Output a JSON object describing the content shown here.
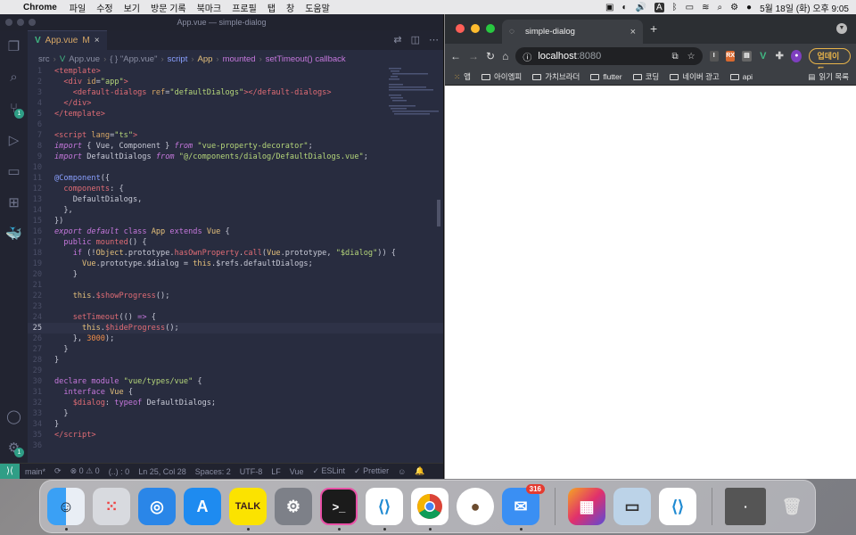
{
  "menubar": {
    "app": "Chrome",
    "items": [
      "파일",
      "수정",
      "보기",
      "방문 기록",
      "북마크",
      "프로필",
      "탭",
      "창",
      "도움말"
    ],
    "clock": "5월 18일 (화) 오후 9:05"
  },
  "vscode": {
    "window_title": "App.vue — simple-dialog",
    "tab": {
      "label": "App.vue",
      "modified": "M",
      "close": "×"
    },
    "breadcrumb": [
      "src",
      "App.vue",
      "{ } \"App.vue\"",
      "script",
      "App",
      "mounted",
      "setTimeout() callback"
    ],
    "badges": {
      "scm": "1",
      "accounts": "1"
    },
    "current_line": 25,
    "lines": [
      {
        "n": "1",
        "html": "<span class='tag'>&lt;template&gt;</span>"
      },
      {
        "n": "2",
        "html": "  <span class='tag'>&lt;div</span> <span class='attr'>id</span><span class='pun'>=</span><span class='str'>\"app\"</span><span class='tag'>&gt;</span>"
      },
      {
        "n": "3",
        "html": "    <span class='tag'>&lt;default-dialogs</span> <span class='attr'>ref</span><span class='pun'>=</span><span class='str'>\"defaultDialogs\"</span><span class='tag'>&gt;&lt;/default-dialogs&gt;</span>"
      },
      {
        "n": "4",
        "html": "  <span class='tag'>&lt;/div&gt;</span>"
      },
      {
        "n": "5",
        "html": "<span class='tag'>&lt;/template&gt;</span>"
      },
      {
        "n": "6",
        "html": ""
      },
      {
        "n": "7",
        "html": "<span class='tag'>&lt;script</span> <span class='attr'>lang</span><span class='pun'>=</span><span class='str'>\"ts\"</span><span class='tag'>&gt;</span>"
      },
      {
        "n": "8",
        "html": "<span class='kw'>import</span> { Vue, Component } <span class='kw'>from</span> <span class='str'>\"vue-property-decorator\"</span>;"
      },
      {
        "n": "9",
        "html": "<span class='kw'>import</span> DefaultDialogs <span class='kw'>from</span> <span class='str'>\"@/components/dialog/DefaultDialogs.vue\"</span>;"
      },
      {
        "n": "10",
        "html": ""
      },
      {
        "n": "11",
        "html": "<span class='dec'>@Component</span>({"
      },
      {
        "n": "12",
        "html": "  <span class='fn'>components</span>: {"
      },
      {
        "n": "13",
        "html": "    DefaultDialogs,"
      },
      {
        "n": "14",
        "html": "  },"
      },
      {
        "n": "15",
        "html": "})"
      },
      {
        "n": "16",
        "html": "<span class='kw'>export</span> <span class='kw'>default</span> <span class='kw2'>class</span> <span class='cls'>App</span> <span class='kw2'>extends</span> <span class='cls'>Vue</span> {"
      },
      {
        "n": "17",
        "html": "  <span class='kw2'>public</span> <span class='fn'>mounted</span>() {"
      },
      {
        "n": "18",
        "html": "    <span class='kw2'>if</span> (!<span class='cls'>Object</span>.prototype.<span class='fn'>hasOwnProperty</span>.<span class='fn'>call</span>(<span class='cls'>Vue</span>.prototype, <span class='str'>\"$dialog\"</span>)) {"
      },
      {
        "n": "19",
        "html": "      <span class='cls'>Vue</span>.prototype.$dialog = <span class='this'>this</span>.$refs.defaultDialogs;"
      },
      {
        "n": "20",
        "html": "    }"
      },
      {
        "n": "21",
        "html": ""
      },
      {
        "n": "22",
        "html": "    <span class='this'>this</span>.<span class='fn'>$showProgress</span>();"
      },
      {
        "n": "23",
        "html": ""
      },
      {
        "n": "24",
        "html": "    <span class='fn'>setTimeout</span>(() <span class='kw2'>=&gt;</span> {"
      },
      {
        "n": "25",
        "html": "      <span class='this'>this</span>.<span class='fn'>$hideProgress</span>();"
      },
      {
        "n": "26",
        "html": "    }, <span class='num'>3000</span>);"
      },
      {
        "n": "27",
        "html": "  }"
      },
      {
        "n": "28",
        "html": "}"
      },
      {
        "n": "29",
        "html": ""
      },
      {
        "n": "30",
        "html": "<span class='kw2'>declare</span> <span class='kw2'>module</span> <span class='str'>\"vue/types/vue\"</span> {"
      },
      {
        "n": "31",
        "html": "  <span class='kw2'>interface</span> <span class='cls'>Vue</span> {"
      },
      {
        "n": "32",
        "html": "    <span class='fn'>$dialog</span>: <span class='kw2'>typeof</span> DefaultDialogs;"
      },
      {
        "n": "33",
        "html": "  }"
      },
      {
        "n": "34",
        "html": "}"
      },
      {
        "n": "35",
        "html": "<span class='tag'>&lt;/script&gt;</span>"
      },
      {
        "n": "36",
        "html": ""
      }
    ],
    "status": {
      "branch": "main*",
      "errors": "⊗ 0 ⚠ 0",
      "selection": "(..) : 0",
      "position": "Ln 25, Col 28",
      "spaces": "Spaces: 2",
      "encoding": "UTF-8",
      "eol": "LF",
      "language": "Vue",
      "eslint": "✓ ESLint",
      "prettier": "✓ Prettier"
    }
  },
  "chrome": {
    "tab_title": "simple-dialog",
    "url_host": "localhost",
    "url_port": ":8080",
    "update_label": "업데이트",
    "bookmarks": [
      "앱",
      "아이엠피",
      "가치브라더",
      "flutter",
      "코딩",
      "네이버 광고",
      "api"
    ],
    "reading_list": "읽기 목록"
  },
  "dock": {
    "mail_badge": "316",
    "kakao_label": "TALK"
  },
  "colors": {
    "accent_teal": "#2f9e86",
    "vue_green": "#41b883",
    "update_orange": "#e8b44a"
  }
}
